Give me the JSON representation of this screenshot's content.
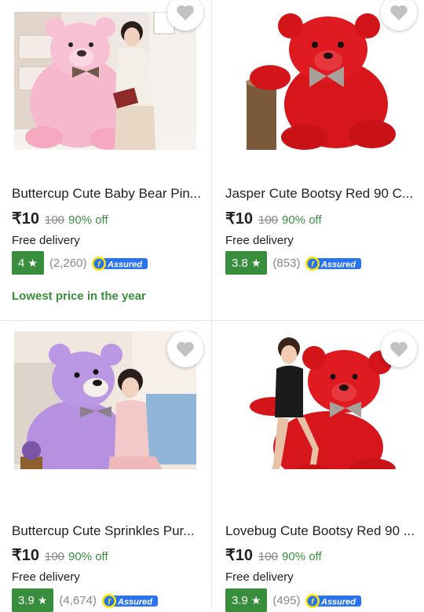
{
  "currency_symbol": "₹",
  "colors": {
    "rating_green": "#388e3c",
    "discount_green": "#388e3c",
    "assured_blue": "#2874f0",
    "text": "#212121",
    "muted": "#878787"
  },
  "products": [
    {
      "title": "Buttercup Cute Baby Bear Pin...",
      "price": "₹10",
      "mrp": "100",
      "discount": "90% off",
      "delivery": "Free delivery",
      "rating": "4",
      "rating_count": "(2,260)",
      "assured_label": "Assured",
      "offer_note": "Lowest price in the year",
      "image": "pink-teddy-bear-with-woman",
      "wishlist_icon": "heart-icon"
    },
    {
      "title": "Jasper Cute Bootsy Red 90 C...",
      "price": "₹10",
      "mrp": "100",
      "discount": "90% off",
      "delivery": "Free delivery",
      "rating": "3.8",
      "rating_count": "(853)",
      "assured_label": "Assured",
      "image": "red-teddy-bear-on-stump",
      "wishlist_icon": "heart-icon"
    },
    {
      "title": "Buttercup Cute Sprinkles Pur...",
      "price": "₹10",
      "mrp": "100",
      "discount": "90% off",
      "delivery": "Free delivery",
      "rating": "3.9",
      "rating_count": "(4,674)",
      "assured_label": "Assured",
      "image": "purple-teddy-bear-with-woman",
      "wishlist_icon": "heart-icon"
    },
    {
      "title": "Lovebug Cute Bootsy Red 90 ...",
      "price": "₹10",
      "mrp": "100",
      "discount": "90% off",
      "delivery": "Free delivery",
      "rating": "3.9",
      "rating_count": "(495)",
      "assured_label": "Assured",
      "image": "red-teddy-bear-with-woman",
      "wishlist_icon": "heart-icon"
    }
  ]
}
